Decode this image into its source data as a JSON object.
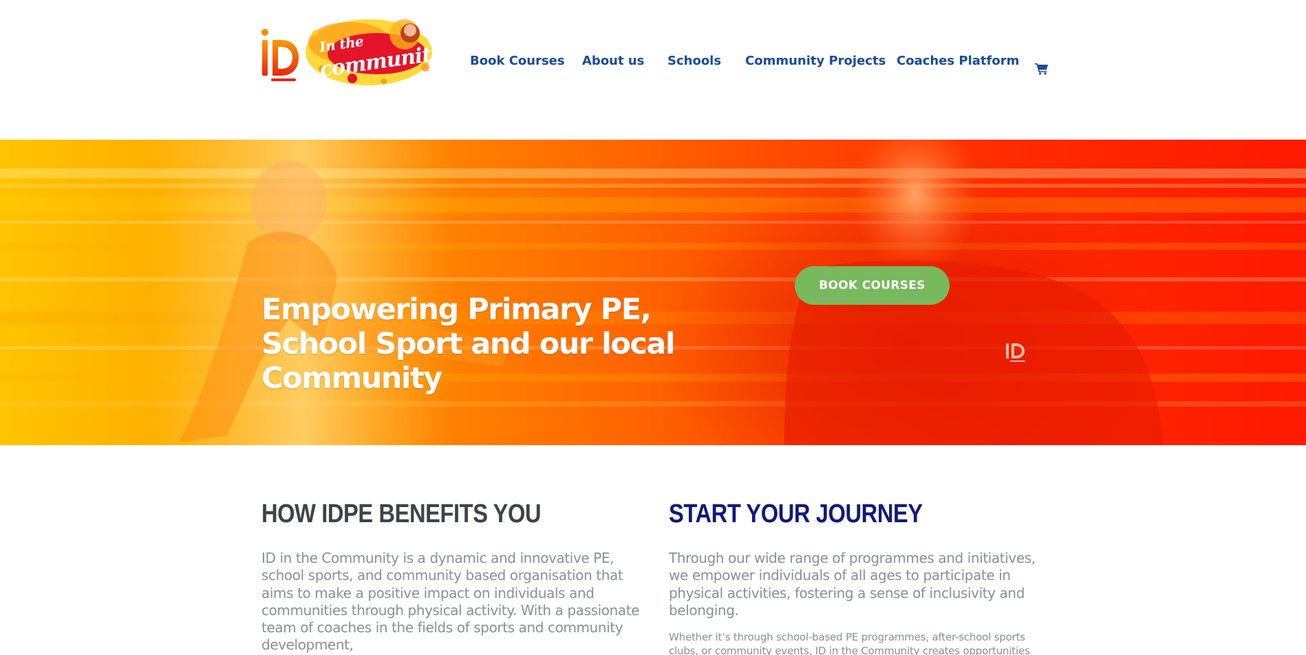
{
  "logo": {
    "alt": "ID in the community",
    "tagline_line1": "In the",
    "tagline_line2": "community"
  },
  "nav": {
    "items": [
      {
        "label": "Book Courses"
      },
      {
        "label": "About us"
      },
      {
        "label": "Schools"
      },
      {
        "label": "Community Projects"
      },
      {
        "label": "Coaches Platform"
      }
    ],
    "cart_icon": "shopping-cart-icon"
  },
  "hero": {
    "title": "Empowering Primary PE, School Sport and our local Community",
    "button_label": "BOOK COURSES"
  },
  "sections": {
    "benefits": {
      "heading": "HOW IDPE BENEFITS YOU",
      "body": "ID in the Community is a dynamic and innovative PE, school sports, and community based organisation that aims to make a positive impact on individuals and communities through physical activity. With a passionate team of coaches in the fields of sports and community development,"
    },
    "journey": {
      "heading": "START YOUR JOURNEY",
      "body": "Through our wide range of programmes and initiatives, we empower individuals of all ages to participate in physical activities, fostering a sense of inclusivity and belonging.",
      "secondary": "Whether it’s through school-based PE programmes, after-school sports clubs, or community events, ID in the Community creates opportunities"
    }
  },
  "colors": {
    "nav_link": "#1b4a9c",
    "button_green": "#78b95d",
    "heading_dark": "#3d4348",
    "heading_navy": "#101a7a",
    "body_text": "#8a8f97"
  }
}
